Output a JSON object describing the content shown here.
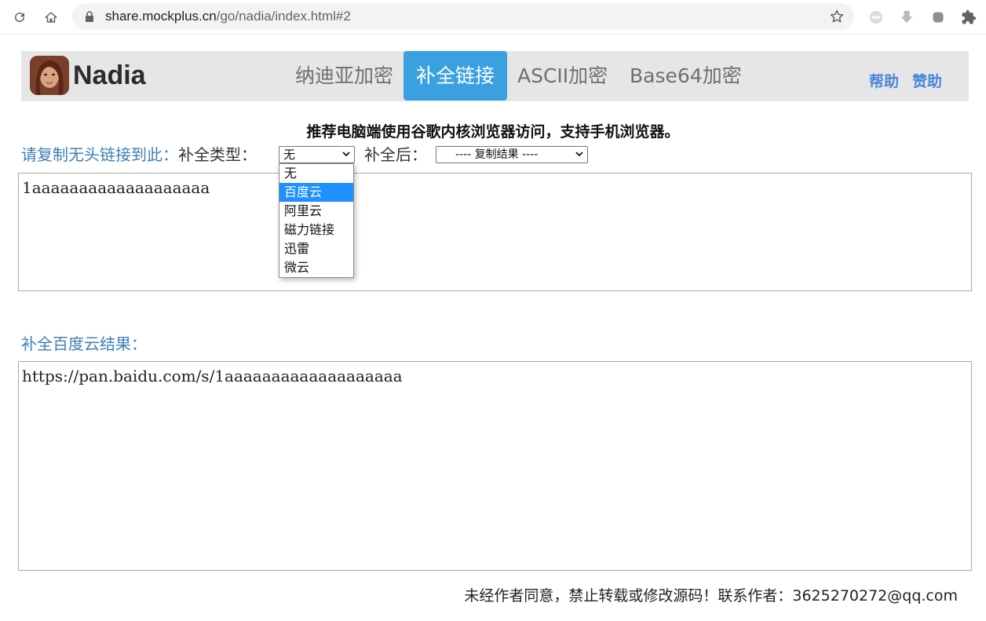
{
  "browser": {
    "url_host": "share.mockplus.cn",
    "url_path": "/go/nadia/index.html#2"
  },
  "site": {
    "logo_text": "Nadia",
    "tabs": [
      {
        "label": "纳迪亚加密",
        "active": false
      },
      {
        "label": "补全链接",
        "active": true
      },
      {
        "label": "ASCII加密",
        "active": false
      },
      {
        "label": "Base64加密",
        "active": false
      }
    ],
    "links": {
      "help": "帮助",
      "sponsor": "赞助"
    },
    "accent_color": "#3ba0e0"
  },
  "notice": "推荐电脑端使用谷歌内核浏览器访问，支持手机浏览器。",
  "form": {
    "paste_label": "请复制无头链接到此：",
    "type_label": "补全类型：",
    "type_selected": "无",
    "after_label": "补全后：",
    "after_selected": "---- 复制结果 ----",
    "type_options": [
      {
        "label": "无",
        "highlighted": false
      },
      {
        "label": "百度云",
        "highlighted": true
      },
      {
        "label": "阿里云",
        "highlighted": false
      },
      {
        "label": "磁力链接",
        "highlighted": false
      },
      {
        "label": "迅雷",
        "highlighted": false
      },
      {
        "label": "微云",
        "highlighted": false
      }
    ],
    "input_value": "1aaaaaaaaaaaaaaaaaaa"
  },
  "result": {
    "label": "补全百度云结果：",
    "value": "https://pan.baidu.com/s/1aaaaaaaaaaaaaaaaaaa"
  },
  "footer": "未经作者同意，禁止转载或修改源码！联系作者：3625270272@qq.com"
}
